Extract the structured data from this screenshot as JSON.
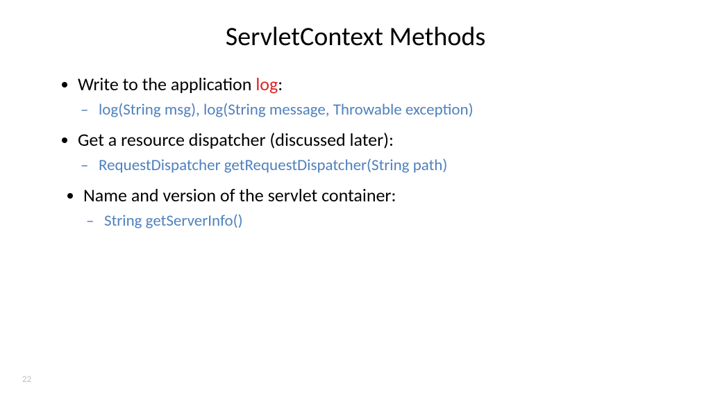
{
  "title": "ServletContext Methods",
  "bullets": {
    "b1_pre": "Write to the application ",
    "b1_red": "log",
    "b1_post": ":",
    "b1_sub": "log(String msg), log(String message, Throwable exception)",
    "b2": "Get a resource dispatcher (discussed later):",
    "b2_sub": "RequestDispatcher getRequestDispatcher(String path)",
    "b3": "Name and version of the servlet container:",
    "b3_sub": "String getServerInfo()"
  },
  "pageNumber": "22"
}
